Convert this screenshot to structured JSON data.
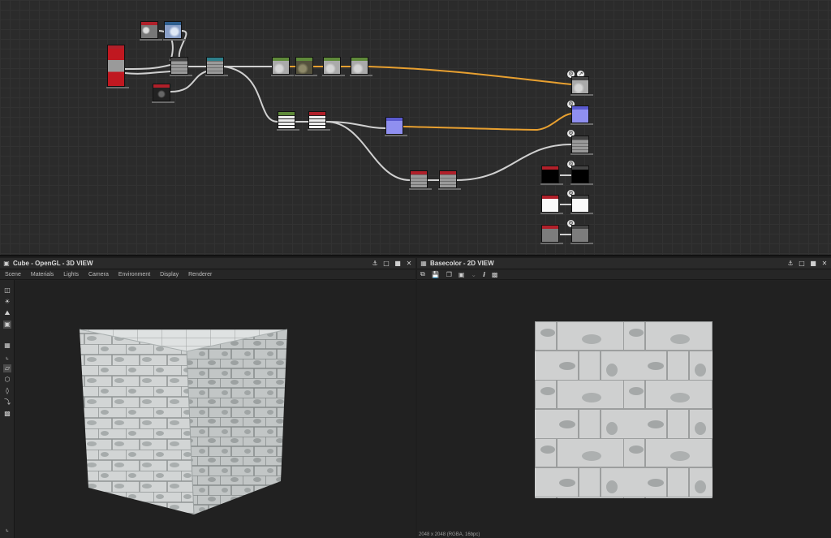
{
  "panel3d": {
    "title": "Cube - OpenGL - 3D VIEW",
    "menu": [
      "Scene",
      "Materials",
      "Lights",
      "Camera",
      "Environment",
      "Display",
      "Renderer"
    ]
  },
  "panel2d": {
    "title": "Basecolor - 2D VIEW",
    "status": "2048 x 2048 (RGBA, 16bpc)"
  },
  "colors": {
    "graph_bg": "#2b2b2b",
    "wire": "#d0d0d0",
    "wire_active": "#e8a030",
    "header_red": "#b0202a",
    "header_teal": "#2e7f8a",
    "header_green": "#5f8a3a",
    "output_normal": "#8f8ff0"
  },
  "icons": {
    "pin": "pin-icon",
    "restore": "restore-icon",
    "maximize": "maximize-icon",
    "close": "close-icon"
  }
}
